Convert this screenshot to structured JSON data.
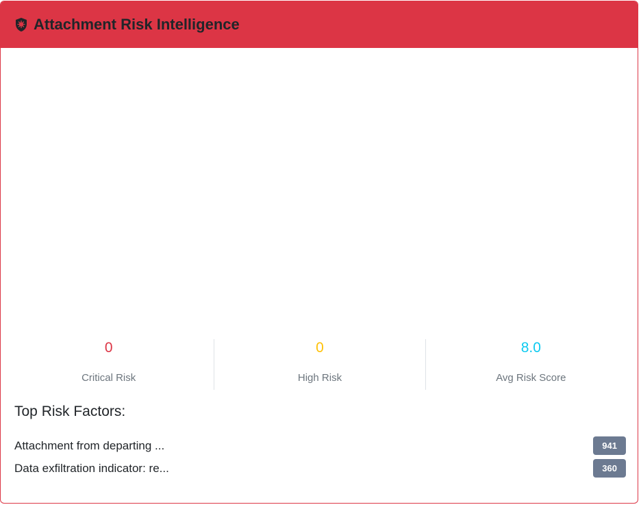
{
  "header": {
    "title": "Attachment Risk Intelligence",
    "icon": "shield-virus-icon",
    "background_color": "#dc3545"
  },
  "stats": [
    {
      "value": "0",
      "label": "Critical Risk",
      "color": "#dc3545"
    },
    {
      "value": "0",
      "label": "High Risk",
      "color": "#ffc107"
    },
    {
      "value": "8.0",
      "label": "Avg Risk Score",
      "color": "#0dcaf0"
    }
  ],
  "factors": {
    "title": "Top Risk Factors:",
    "items": [
      {
        "label": "Attachment from departing ...",
        "count": "941"
      },
      {
        "label": "Data exfiltration indicator: re...",
        "count": "360"
      }
    ],
    "badge_color": "#6c7a91"
  }
}
